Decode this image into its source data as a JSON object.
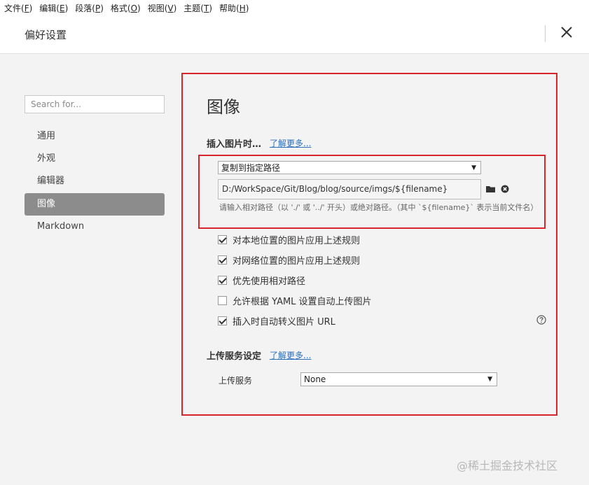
{
  "menu": [
    {
      "label": "文件(",
      "key": "F",
      "end": ")"
    },
    {
      "label": "编辑(",
      "key": "E",
      "end": ")"
    },
    {
      "label": "段落(",
      "key": "P",
      "end": ")"
    },
    {
      "label": "格式(",
      "key": "O",
      "end": ")"
    },
    {
      "label": "视图(",
      "key": "V",
      "end": ")"
    },
    {
      "label": "主题(",
      "key": "T",
      "end": ")"
    },
    {
      "label": "帮助(",
      "key": "H",
      "end": ")"
    }
  ],
  "header": {
    "title": "偏好设置"
  },
  "sidebar": {
    "search_placeholder": "Search for...",
    "items": [
      {
        "label": "通用"
      },
      {
        "label": "外观"
      },
      {
        "label": "编辑器"
      },
      {
        "label": "图像"
      },
      {
        "label": "Markdown"
      }
    ]
  },
  "image": {
    "title": "图像",
    "insert_label": "插入图片时…",
    "learn_more": "了解更多...",
    "insert_select": "复制到指定路径",
    "path_value": "D:/WorkSpace/Git/Blog/blog/source/imgs/${filename}",
    "hint": "请输入相对路径（以 './' 或 '../' 开头）或绝对路径。（其中 `${filename}` 表示当前文件名）",
    "checkboxes": [
      {
        "label": "对本地位置的图片应用上述规则",
        "checked": true
      },
      {
        "label": "对网络位置的图片应用上述规则",
        "checked": true
      },
      {
        "label": "优先使用相对路径",
        "checked": true
      },
      {
        "label": "允许根据 YAML 设置自动上传图片",
        "checked": false
      },
      {
        "label": "插入时自动转义图片 URL",
        "checked": true
      }
    ],
    "upload_label": "上传服务设定",
    "upload_learn_more": "了解更多...",
    "upload_service_label": "上传服务",
    "upload_service_value": "None"
  },
  "watermark": "@稀土掘金技术社区",
  "colors": {
    "accent": "#2a6fbf",
    "highlight": "#d9262c",
    "active_nav": "#8c8c8c"
  }
}
